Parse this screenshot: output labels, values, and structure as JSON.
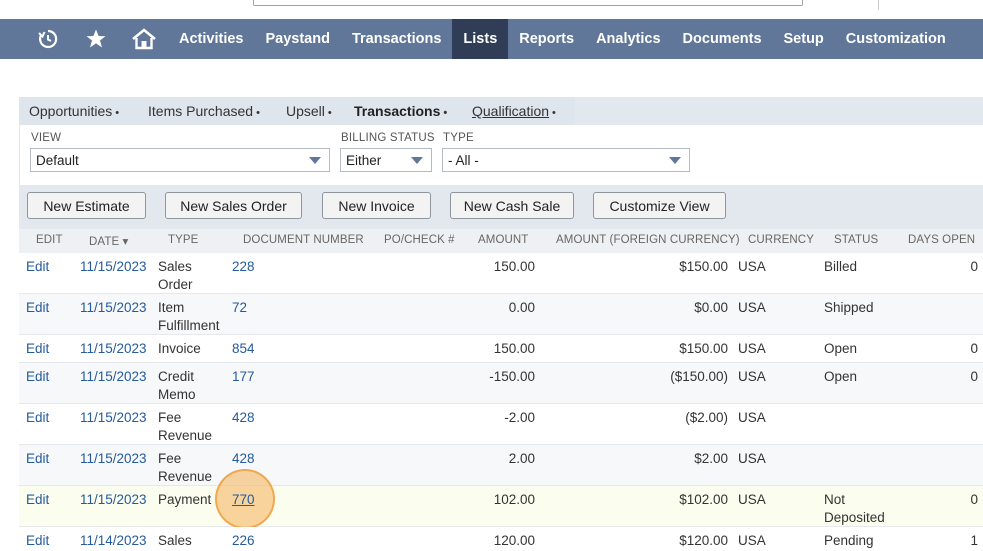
{
  "nav": {
    "items": [
      {
        "label": "Activities"
      },
      {
        "label": "Paystand"
      },
      {
        "label": "Transactions"
      },
      {
        "label": "Lists",
        "active": true
      },
      {
        "label": "Reports"
      },
      {
        "label": "Analytics"
      },
      {
        "label": "Documents"
      },
      {
        "label": "Setup"
      },
      {
        "label": "Customization"
      }
    ],
    "icons": [
      "recent-records-icon",
      "star-icon",
      "home-icon"
    ],
    "bar_color": "#607799",
    "active_color": "#2f3e56"
  },
  "subtabs": {
    "items": [
      {
        "label": "Opportunities"
      },
      {
        "label": "Items Purchased"
      },
      {
        "label": "Upsell"
      },
      {
        "label": "Transactions"
      },
      {
        "label": "Qualification"
      }
    ],
    "bullet": "•"
  },
  "filters": {
    "view_label": "VIEW",
    "view_value": "Default",
    "billing_label": "BILLING STATUS",
    "billing_value": "Either",
    "type_label": "TYPE",
    "type_value": "- All -"
  },
  "buttons": {
    "new_estimate": "New Estimate",
    "new_sales_order": "New Sales Order",
    "new_invoice": "New Invoice",
    "new_cash_sale": "New Cash Sale",
    "customize_view": "Customize View"
  },
  "table": {
    "headers": {
      "edit": "EDIT",
      "date": "DATE ▾",
      "type": "TYPE",
      "doc": "DOCUMENT NUMBER",
      "po": "PO/CHECK #",
      "amount": "AMOUNT",
      "amount_fc": "AMOUNT (FOREIGN CURRENCY)",
      "currency": "CURRENCY",
      "status": "STATUS",
      "days": "DAYS OPEN"
    },
    "rows": [
      {
        "edit": "Edit",
        "date": "11/15/2023",
        "type1": "Sales",
        "type2": "Order",
        "doc": "228",
        "amount": "150.00",
        "amount_fc": "$150.00",
        "currency": "USA",
        "status1": "Billed",
        "status2": "",
        "days": "0"
      },
      {
        "edit": "Edit",
        "date": "11/15/2023",
        "type1": "Item",
        "type2": "Fulfillment",
        "doc": "72",
        "amount": "0.00",
        "amount_fc": "$0.00",
        "currency": "USA",
        "status1": "Shipped",
        "status2": "",
        "days": ""
      },
      {
        "edit": "Edit",
        "date": "11/15/2023",
        "type1": "Invoice",
        "type2": "",
        "doc": "854",
        "amount": "150.00",
        "amount_fc": "$150.00",
        "currency": "USA",
        "status1": "Open",
        "status2": "",
        "days": "0"
      },
      {
        "edit": "Edit",
        "date": "11/15/2023",
        "type1": "Credit",
        "type2": "Memo",
        "doc": "177",
        "amount": "-150.00",
        "amount_fc": "($150.00)",
        "currency": "USA",
        "status1": "Open",
        "status2": "",
        "days": "0"
      },
      {
        "edit": "Edit",
        "date": "11/15/2023",
        "type1": "Fee",
        "type2": "Revenue",
        "doc": "428",
        "amount": "-2.00",
        "amount_fc": "($2.00)",
        "currency": "USA",
        "status1": "",
        "status2": "",
        "days": ""
      },
      {
        "edit": "Edit",
        "date": "11/15/2023",
        "type1": "Fee",
        "type2": "Revenue",
        "doc": "428",
        "amount": "2.00",
        "amount_fc": "$2.00",
        "currency": "USA",
        "status1": "",
        "status2": "",
        "days": ""
      },
      {
        "edit": "Edit",
        "date": "11/15/2023",
        "type1": "Payment",
        "type2": "",
        "doc": "770",
        "amount": "102.00",
        "amount_fc": "$102.00",
        "currency": "USA",
        "status1": "Not",
        "status2": "Deposited",
        "days": "0"
      },
      {
        "edit": "Edit",
        "date": "11/14/2023",
        "type1": "Sales",
        "type2": "",
        "doc": "226",
        "amount": "120.00",
        "amount_fc": "$120.00",
        "currency": "USA",
        "status1": "Pending",
        "status2": "",
        "days": "1"
      }
    ]
  }
}
